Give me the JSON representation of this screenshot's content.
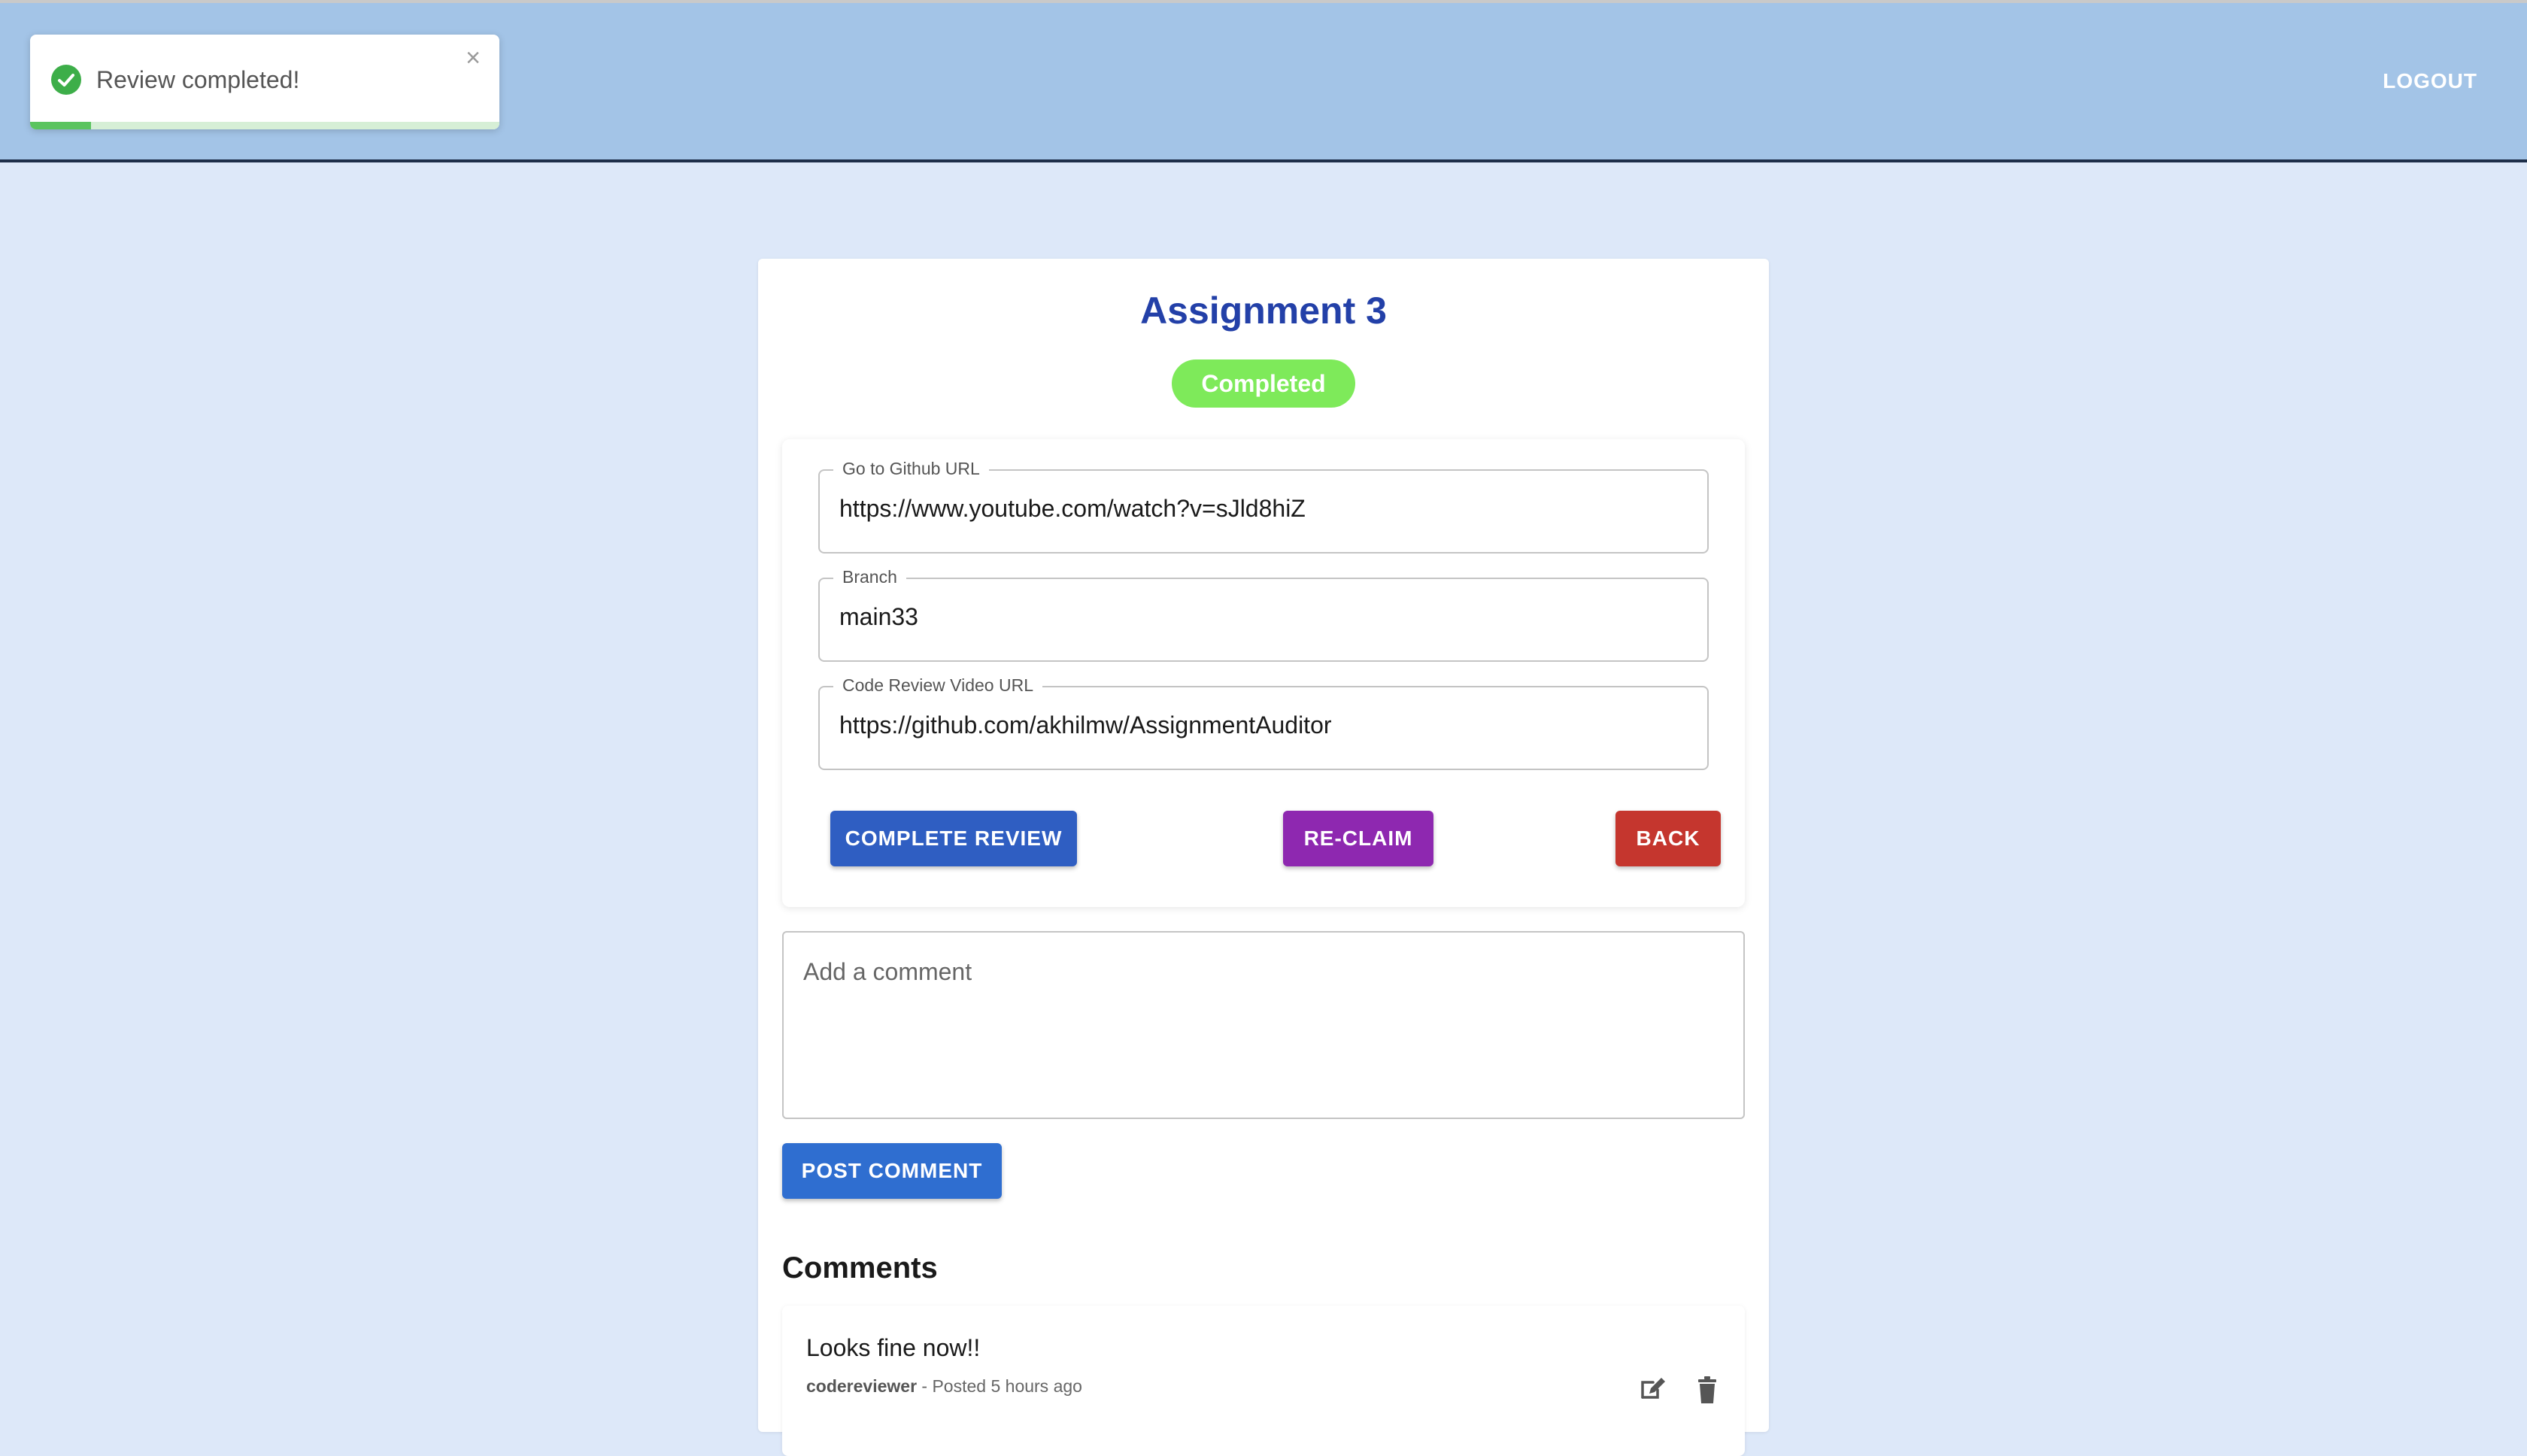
{
  "header": {
    "logout_label": "LOGOUT"
  },
  "toast": {
    "message": "Review completed!",
    "close_glyph": "×",
    "progress_fraction": 0.13,
    "icon": "check-circle-icon",
    "success_color": "#3dae49"
  },
  "assignment": {
    "title": "Assignment 3",
    "status": "Completed",
    "status_color": "#7eea5a",
    "fields": [
      {
        "label": "Go to Github URL",
        "value": "https://www.youtube.com/watch?v=sJld8hiZ"
      },
      {
        "label": "Branch",
        "value": "main33"
      },
      {
        "label": "Code Review Video URL",
        "value": "https://github.com/akhilmw/AssignmentAuditor"
      }
    ],
    "buttons": {
      "complete_review": "COMPLETE REVIEW",
      "reclaim": "RE-CLAIM",
      "back": "BACK"
    }
  },
  "comment_form": {
    "placeholder": "Add a comment",
    "post_label": "POST COMMENT"
  },
  "comments": {
    "heading": "Comments",
    "items": [
      {
        "text": "Looks fine now!!",
        "author": "codereviewer",
        "posted": " - Posted 5 hours ago",
        "edit_icon": "edit-icon",
        "delete_icon": "trash-icon"
      }
    ]
  },
  "colors": {
    "appbar": "#a3c4e7",
    "page_background": "#dde8f9",
    "title": "#2340a8",
    "complete_button": "#2f5ec2",
    "reclaim_button": "#8e28b0",
    "back_button": "#c5362e",
    "post_button": "#2f6ed0"
  }
}
